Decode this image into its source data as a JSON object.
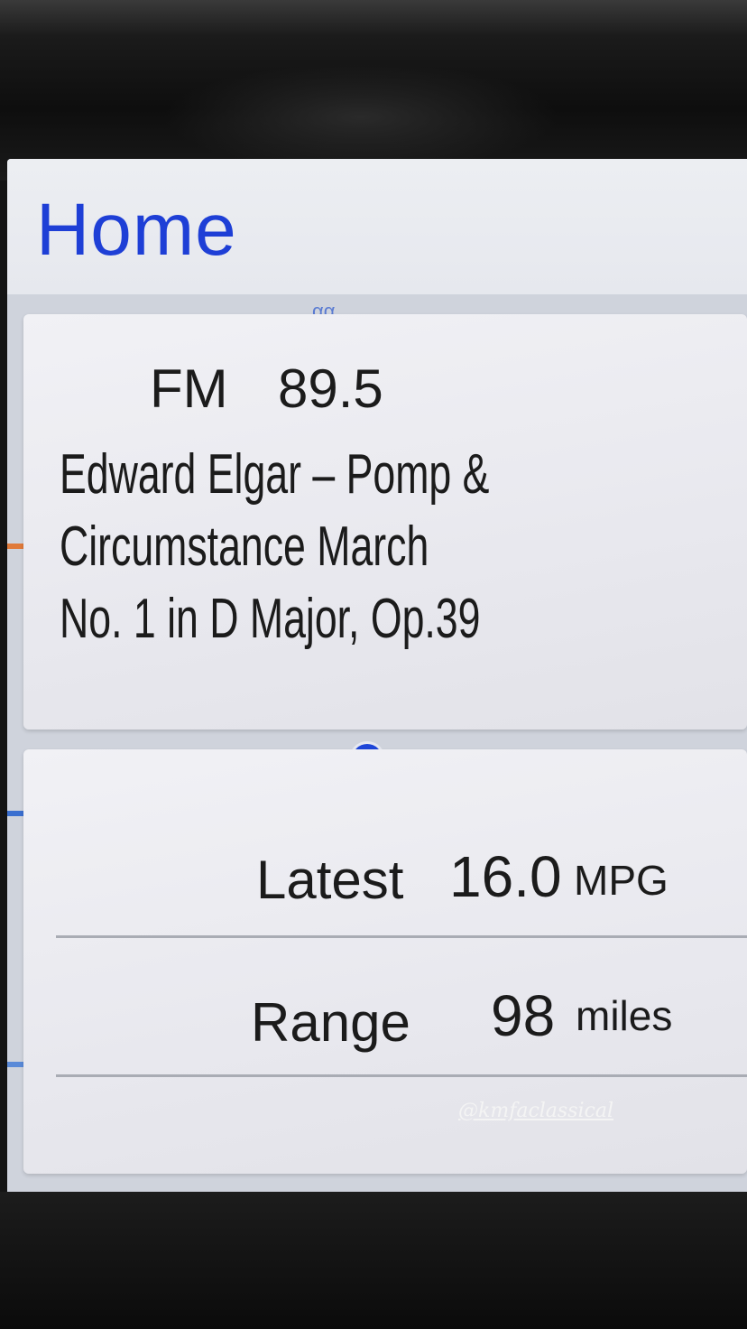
{
  "header": {
    "title": "Home"
  },
  "audio": {
    "band": "FM",
    "frequency": "89.5",
    "track_line1": "Edward Elgar – Pomp & Circumstance March",
    "track_line2": "No. 1 in D Major, Op.39",
    "progress_fraction": 0.41,
    "controls": {
      "previous": "previous-track",
      "pause": "pause",
      "next": "next-track"
    }
  },
  "fuel": {
    "latest_label": "Latest",
    "latest_value": "16.0",
    "latest_unit": "MPG",
    "range_label": "Range",
    "range_value": "98",
    "range_unit": "miles"
  },
  "overlay": {
    "watermark": "@kmfaclassical"
  },
  "colors": {
    "accent": "#1e46d8",
    "title": "#1e3fd6",
    "disabled": "#a8aab2"
  }
}
